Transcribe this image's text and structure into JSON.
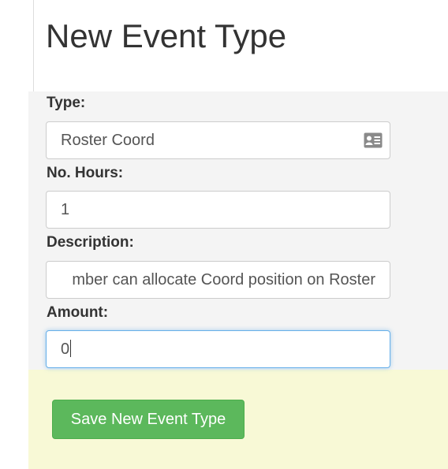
{
  "page": {
    "title": "New Event Type"
  },
  "form": {
    "type": {
      "label": "Type:",
      "value": "Roster Coord",
      "icon": "contact-card-icon"
    },
    "hours": {
      "label": "No. Hours:",
      "value": "1"
    },
    "description": {
      "label": "Description:",
      "value": "mber can allocate Coord position on Roster"
    },
    "amount": {
      "label": "Amount:",
      "value": "0"
    }
  },
  "actions": {
    "save_label": "Save New Event Type"
  },
  "colors": {
    "form_background": "#f4f4f4",
    "footer_background": "#f8f9d6",
    "save_button": "#5cb85c",
    "focus_border": "#66afe9"
  }
}
